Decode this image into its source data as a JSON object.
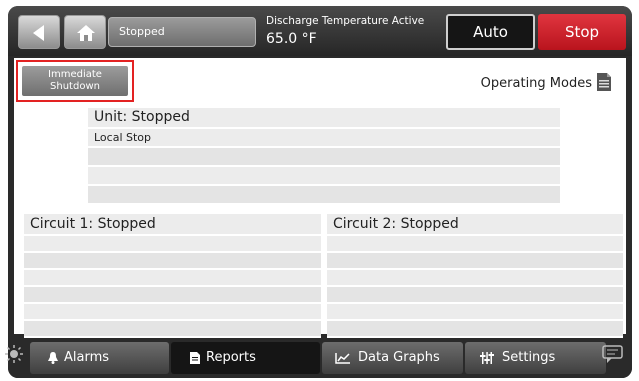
{
  "topbar": {
    "status_text": "Stopped",
    "discharge_label": "Discharge Temperature Active",
    "discharge_value": "65.0 °F",
    "auto_label": "Auto",
    "stop_label": "Stop"
  },
  "main": {
    "shutdown_label_line1": "Immediate",
    "shutdown_label_line2": "Shutdown",
    "operating_modes_label": "Operating Modes",
    "unit_header": "Unit:  Stopped",
    "unit_rows": [
      "Local Stop",
      "",
      "",
      ""
    ],
    "circuit1_header": "Circuit 1:  Stopped",
    "circuit2_header": "Circuit 2:  Stopped"
  },
  "nav": {
    "alarms": "Alarms",
    "reports": "Reports",
    "data_graphs": "Data Graphs",
    "settings": "Settings"
  },
  "colors": {
    "stop_red": "#d0202a",
    "highlight_red": "#e32222"
  }
}
